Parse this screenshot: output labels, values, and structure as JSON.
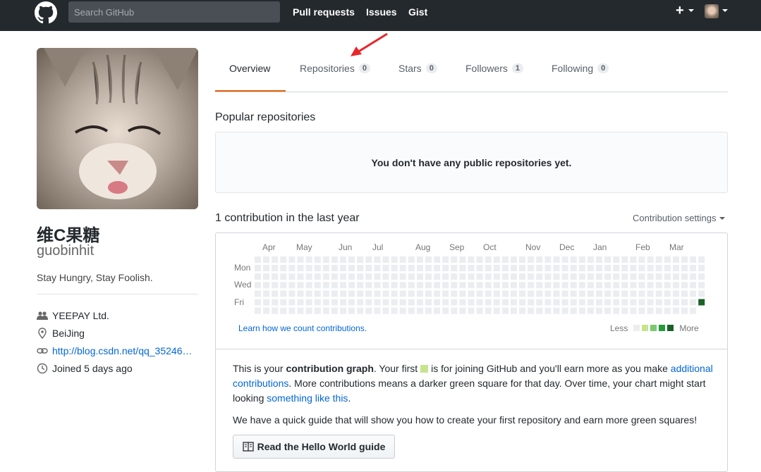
{
  "header": {
    "search_placeholder": "Search GitHub",
    "nav": [
      "Pull requests",
      "Issues",
      "Gist"
    ],
    "plus_label": "+"
  },
  "profile": {
    "name": "维C果糖",
    "login": "guobinhit",
    "bio": "Stay Hungry, Stay Foolish.",
    "company": "YEEPAY Ltd.",
    "location": "BeiJing",
    "blog": "http://blog.csdn.net/qq_35246…",
    "joined": "Joined 5 days ago"
  },
  "tabs": [
    {
      "label": "Overview",
      "count": null,
      "selected": true
    },
    {
      "label": "Repositories",
      "count": "0"
    },
    {
      "label": "Stars",
      "count": "0"
    },
    {
      "label": "Followers",
      "count": "1"
    },
    {
      "label": "Following",
      "count": "0"
    }
  ],
  "popular": {
    "title": "Popular repositories",
    "empty": "You don't have any public repositories yet."
  },
  "contrib": {
    "title": "1 contribution in the last year",
    "settings": "Contribution settings",
    "months": [
      "Apr",
      "May",
      "Jun",
      "Jul",
      "Aug",
      "Sep",
      "Oct",
      "Nov",
      "Dec",
      "Jan",
      "Feb",
      "Mar"
    ],
    "days": [
      "Mon",
      "Wed",
      "Fri"
    ],
    "learn": "Learn how we count contributions.",
    "less": "Less",
    "more": "More",
    "weeks": 53,
    "filled_cell": {
      "week": 52,
      "day": 5
    },
    "colors": [
      "#ebedf0",
      "#c6e48b",
      "#7bc96f",
      "#239a3b",
      "#196127"
    ]
  },
  "info": {
    "p1_a": "This is your ",
    "p1_b": "contribution graph",
    "p1_c": ". Your first",
    "p1_d": "is for joining GitHub and you'll earn more as you make",
    "p1_link1": "additional contributions",
    "p1_e": ". More contributions means a darker green square for that day. Over time, your chart might start looking",
    "p1_link2": "something like this",
    "p1_f": ".",
    "p2": "We have a quick guide that will show you how to create your first repository and earn more green squares!",
    "guide_button": "Read the Hello World guide"
  }
}
